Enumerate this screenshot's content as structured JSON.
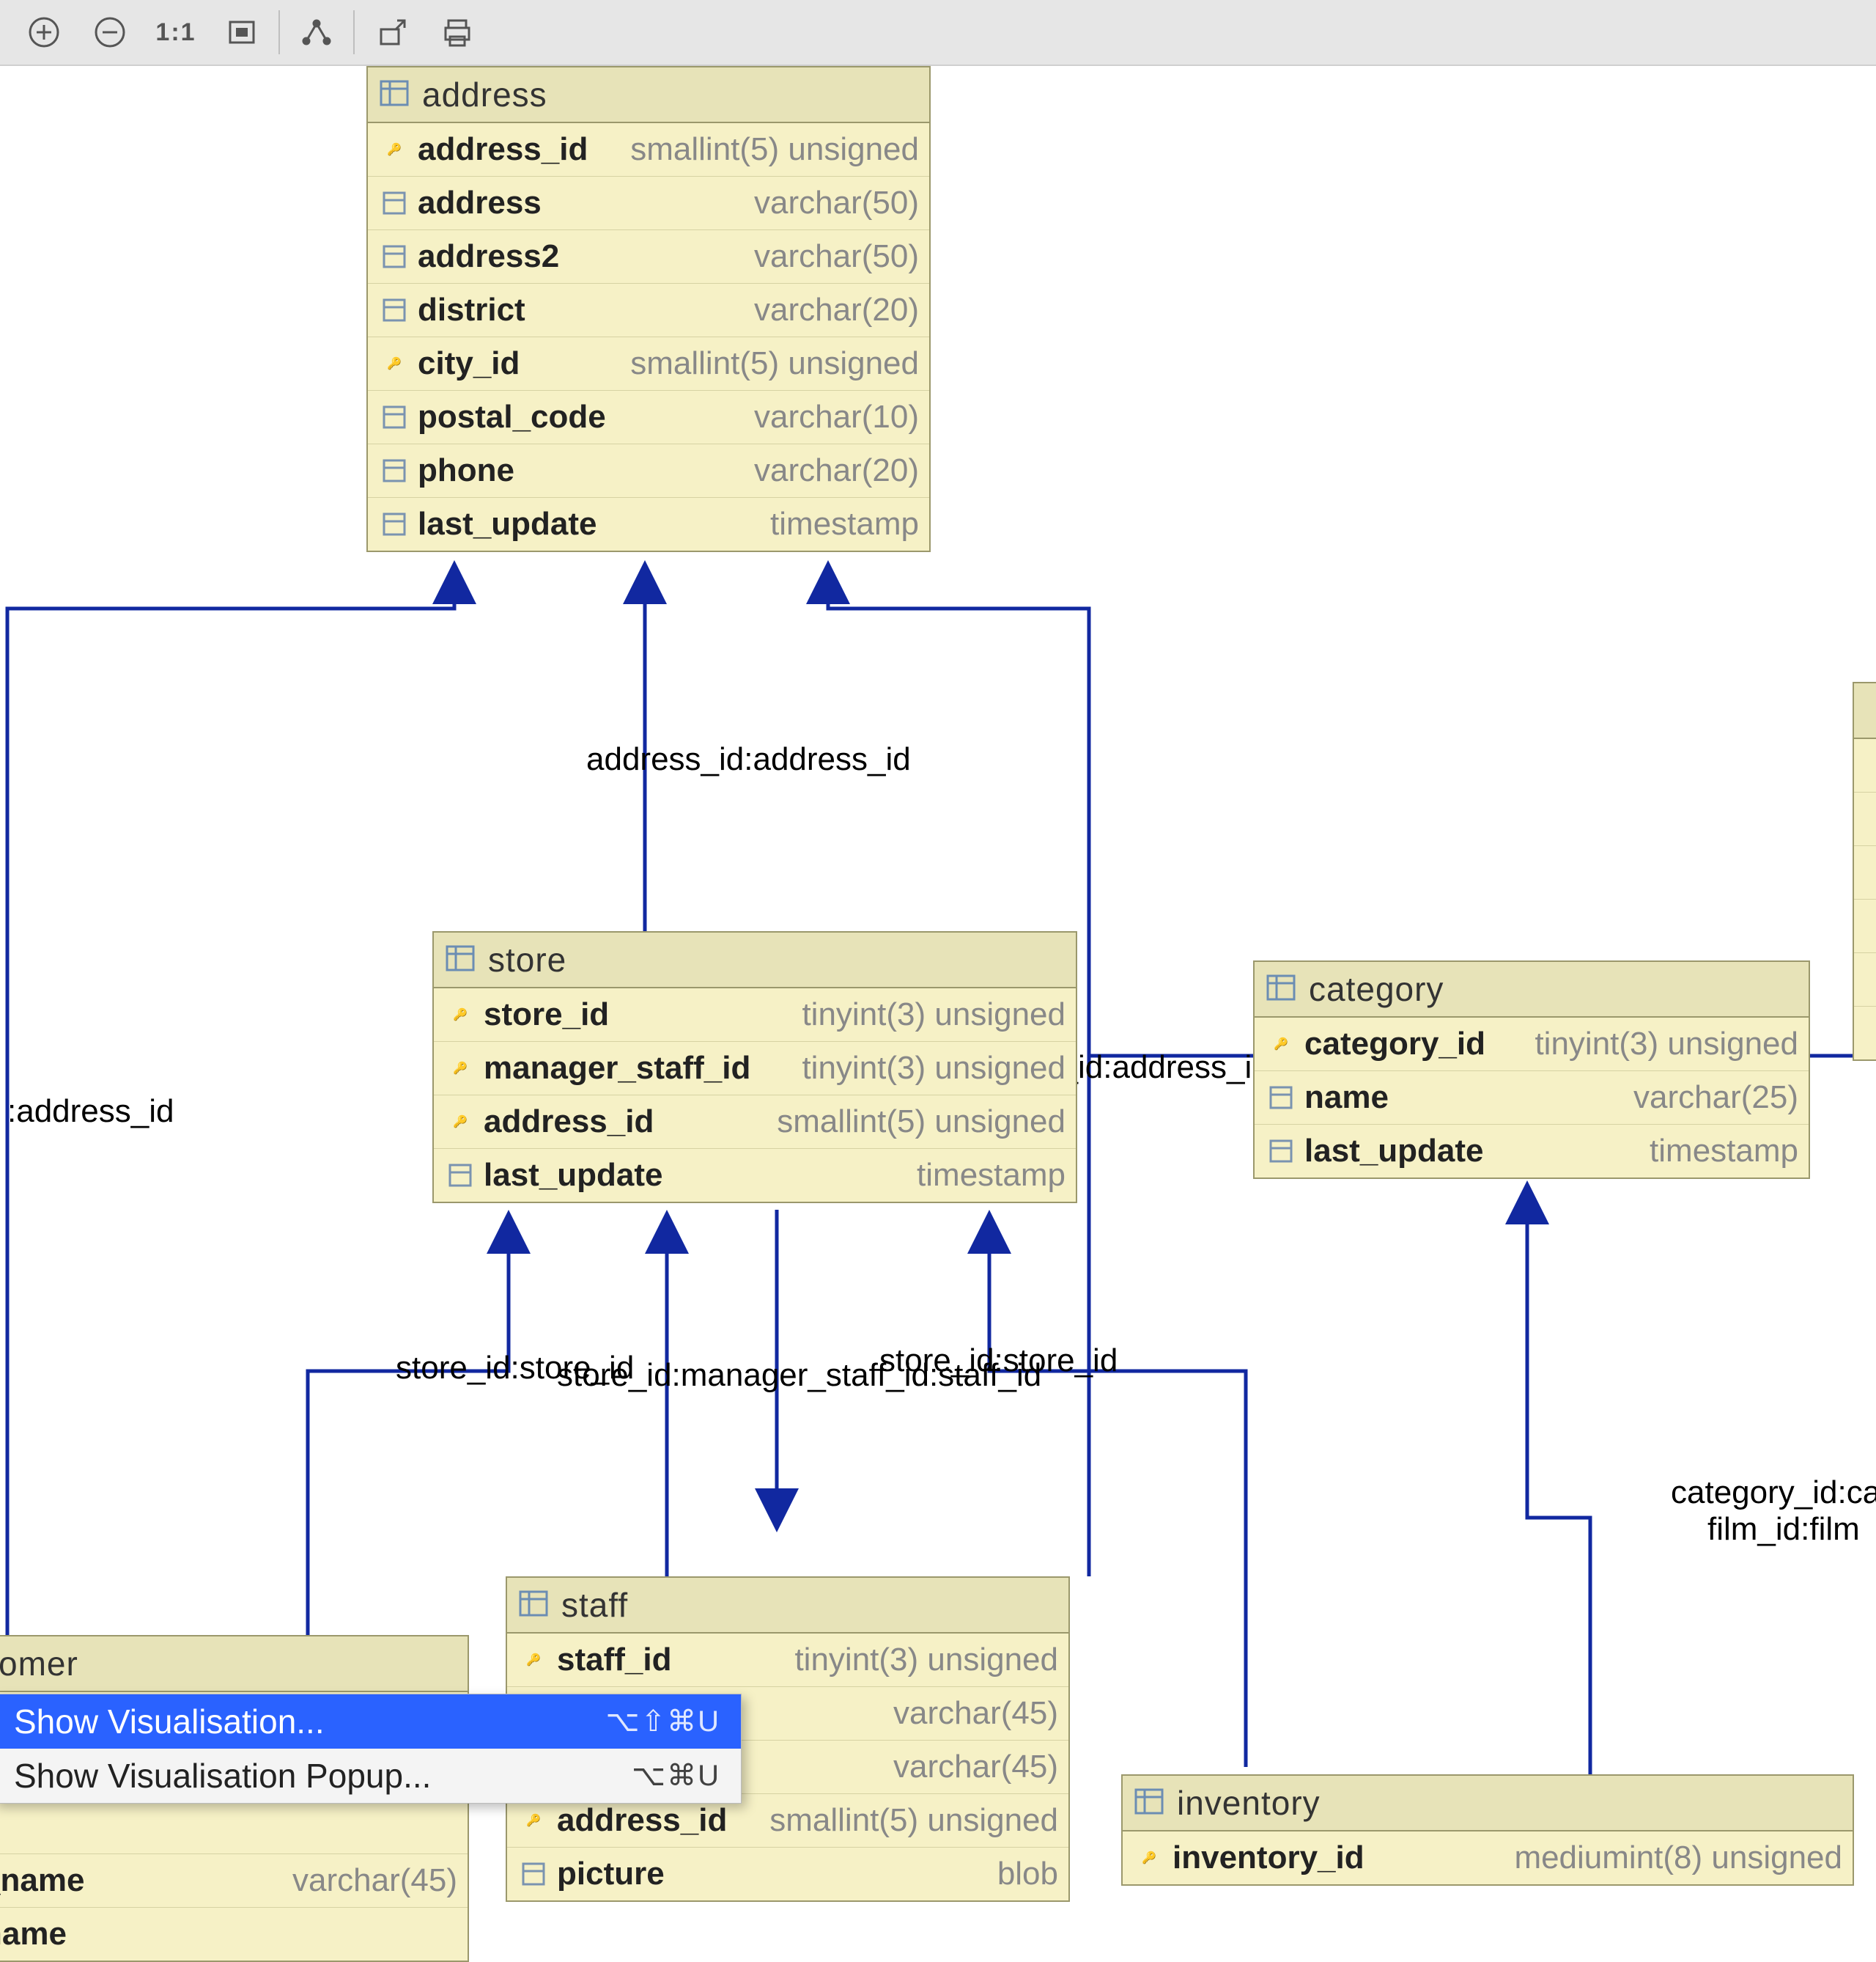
{
  "toolbar": {
    "one_to_one": "1:1"
  },
  "entities": {
    "address": {
      "title": "address",
      "cols": [
        {
          "name": "address_id",
          "type": "smallint(5) unsigned",
          "pk": true
        },
        {
          "name": "address",
          "type": "varchar(50)"
        },
        {
          "name": "address2",
          "type": "varchar(50)"
        },
        {
          "name": "district",
          "type": "varchar(20)"
        },
        {
          "name": "city_id",
          "type": "smallint(5) unsigned",
          "fk": true
        },
        {
          "name": "postal_code",
          "type": "varchar(10)"
        },
        {
          "name": "phone",
          "type": "varchar(20)"
        },
        {
          "name": "last_update",
          "type": "timestamp"
        }
      ]
    },
    "store": {
      "title": "store",
      "cols": [
        {
          "name": "store_id",
          "type": "tinyint(3) unsigned",
          "pk": true
        },
        {
          "name": "manager_staff_id",
          "type": "tinyint(3) unsigned",
          "fk": true
        },
        {
          "name": "address_id",
          "type": "smallint(5) unsigned",
          "fk": true
        },
        {
          "name": "last_update",
          "type": "timestamp"
        }
      ]
    },
    "category": {
      "title": "category",
      "cols": [
        {
          "name": "category_id",
          "type": "tinyint(3) unsigned",
          "pk": true
        },
        {
          "name": "name",
          "type": "varchar(25)"
        },
        {
          "name": "last_update",
          "type": "timestamp"
        }
      ]
    },
    "staff": {
      "title": "staff",
      "cols": [
        {
          "name": "staff_id",
          "type": "tinyint(3) unsigned",
          "pk": true
        },
        {
          "name": "",
          "type": "varchar(45)"
        },
        {
          "name": "",
          "type": "varchar(45)"
        },
        {
          "name": "address_id",
          "type": "smallint(5) unsigned",
          "fk": true
        },
        {
          "name": "picture",
          "type": "blob"
        }
      ]
    },
    "customer": {
      "title_fragment": "omer",
      "cols": [
        {
          "name": "_name",
          "type": "varchar(45)"
        },
        {
          "name": "name",
          "type": ""
        }
      ]
    },
    "inventory": {
      "title": "inventory",
      "cols": [
        {
          "name": "inventory_id",
          "type": "mediumint(8) unsigned",
          "pk": true
        }
      ]
    }
  },
  "relations": {
    "r1": ":address_id",
    "r2": "address_id:address_id",
    "r3": "address_id:address_id",
    "r4": "store_id:store_id",
    "r5": "store_id:manager_staff_id:staff_id",
    "r6": "store_id:store_id",
    "r7": "category_id:cat",
    "r8": "film_id:film"
  },
  "context_menu": {
    "items": [
      {
        "label": "Show Visualisation...",
        "shortcut": "⌥⇧⌘U",
        "selected": true
      },
      {
        "label": "Show Visualisation Popup...",
        "shortcut": "⌥⌘U",
        "selected": false
      }
    ]
  }
}
